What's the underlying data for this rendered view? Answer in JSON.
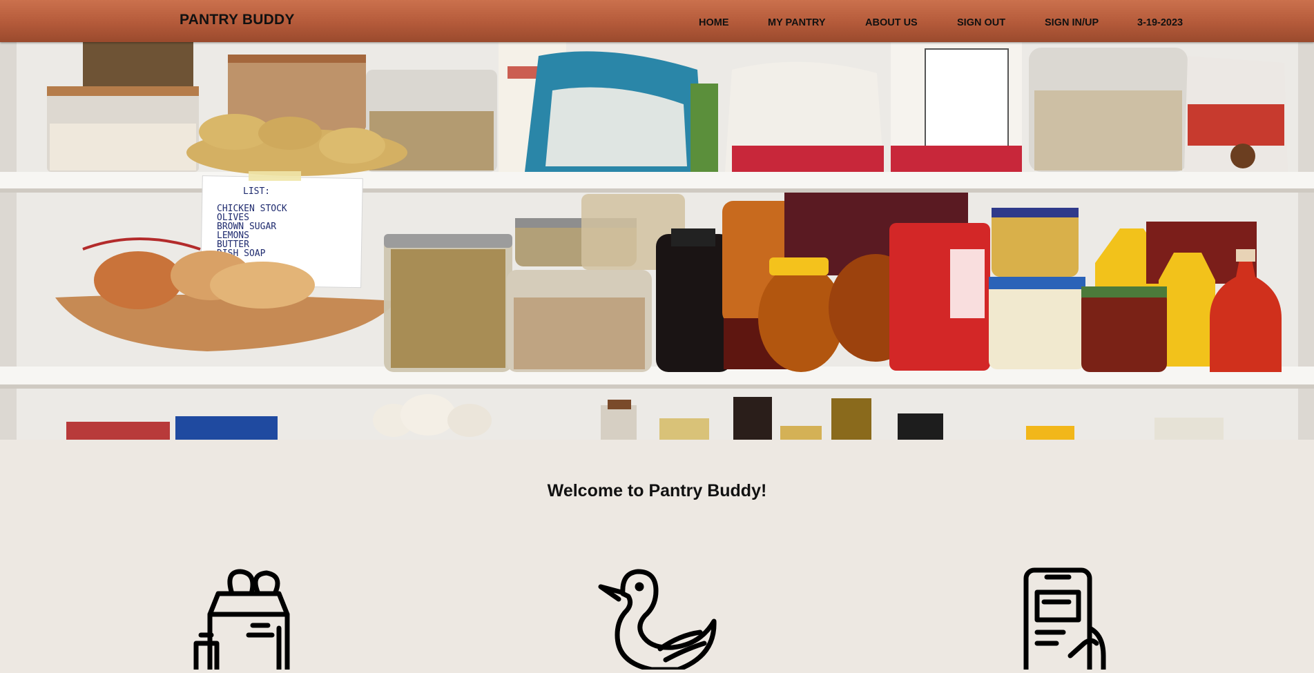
{
  "brand": {
    "name": "PANTRY BUDDY"
  },
  "nav": {
    "home": "HOME",
    "my_pantry": "MY PANTRY",
    "about_us": "ABOUT US",
    "sign_out": "SIGN OUT",
    "sign_in_up": "SIGN IN/UP",
    "date": "3-19-2023"
  },
  "hero": {
    "image": "pantry-shelves-photo",
    "note_title": "LIST:",
    "note_items": [
      "CHICKEN STOCK",
      "OLIVES",
      "BROWN SUGAR",
      "LEMONS",
      "BUTTER",
      "DISH SOAP"
    ]
  },
  "main": {
    "welcome": "Welcome to Pantry Buddy!",
    "features": [
      {
        "icon": "grocery-bag-icon"
      },
      {
        "icon": "duck-icon"
      },
      {
        "icon": "mobile-list-icon"
      }
    ]
  },
  "colors": {
    "nav_top": "#cb714d",
    "nav_bottom": "#9a4a2d",
    "page_background": "#ede8e2",
    "text": "#111111"
  }
}
